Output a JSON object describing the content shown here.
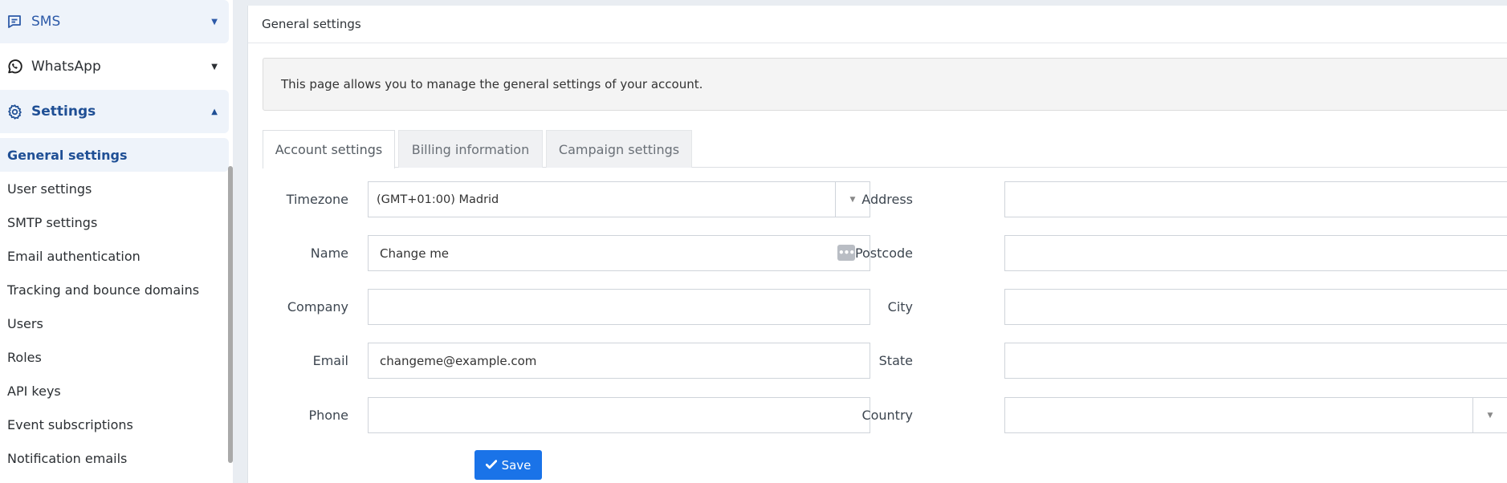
{
  "sidebar": {
    "groups": [
      {
        "label": "SMS",
        "icon": "chat-icon"
      },
      {
        "label": "WhatsApp",
        "icon": "whatsapp-icon"
      },
      {
        "label": "Settings",
        "icon": "gear-icon"
      }
    ],
    "items": [
      {
        "label": "General settings",
        "active": true
      },
      {
        "label": "User settings"
      },
      {
        "label": "SMTP settings"
      },
      {
        "label": "Email authentication"
      },
      {
        "label": "Tracking and bounce domains"
      },
      {
        "label": "Users"
      },
      {
        "label": "Roles"
      },
      {
        "label": "API keys"
      },
      {
        "label": "Event subscriptions"
      },
      {
        "label": "Notification emails"
      }
    ]
  },
  "panel": {
    "title": "General settings",
    "info": "This page allows you to manage the general settings of your account."
  },
  "tabs": [
    {
      "label": "Account settings",
      "active": true
    },
    {
      "label": "Billing information"
    },
    {
      "label": "Campaign settings"
    }
  ],
  "form": {
    "timezone": {
      "label": "Timezone",
      "value": "(GMT+01:00) Madrid"
    },
    "name": {
      "label": "Name",
      "value": "Change me"
    },
    "company": {
      "label": "Company",
      "value": ""
    },
    "email": {
      "label": "Email",
      "value": "changeme@example.com"
    },
    "phone": {
      "label": "Phone",
      "value": ""
    },
    "address": {
      "label": "Address",
      "value": ""
    },
    "postcode": {
      "label": "Postcode",
      "value": ""
    },
    "city": {
      "label": "City",
      "value": ""
    },
    "state": {
      "label": "State",
      "value": ""
    },
    "country": {
      "label": "Country",
      "value": ""
    }
  },
  "save_label": "Save",
  "colors": {
    "accent": "#1a73e8",
    "sidebar_active_bg": "#eef3fa",
    "sidebar_active_text": "#1f4f95"
  }
}
